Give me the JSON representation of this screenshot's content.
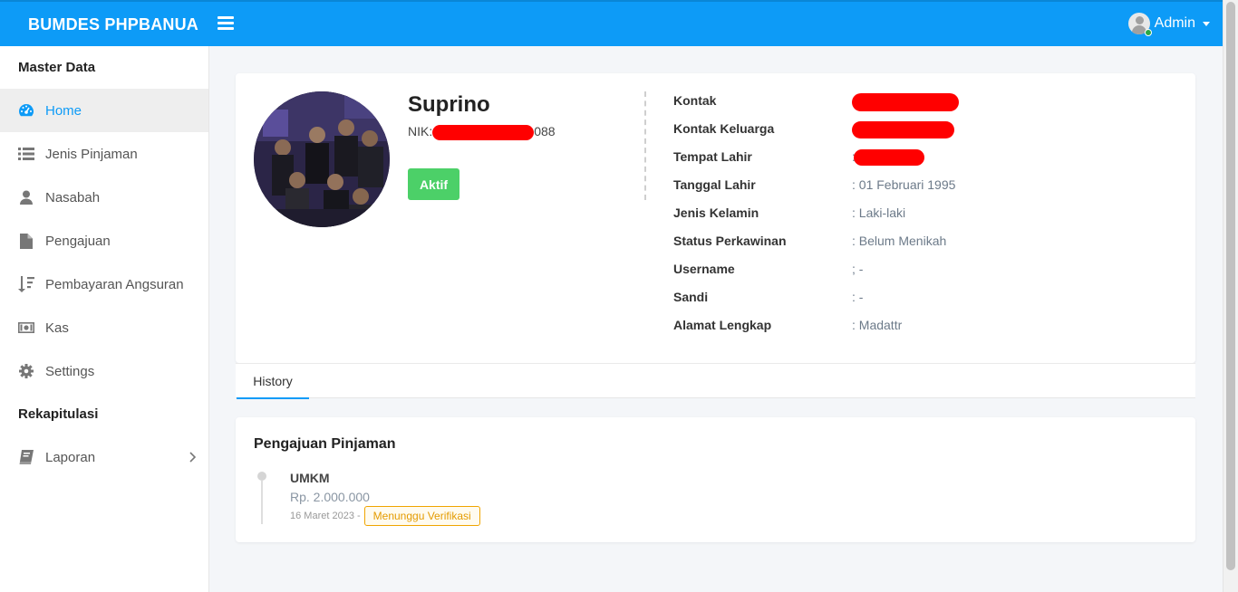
{
  "header": {
    "brand": "BUMDES PHPBANUA",
    "user_name": "Admin"
  },
  "sidebar": {
    "section_master": "Master Data",
    "items": [
      {
        "label": "Home",
        "icon": "dashboard-icon"
      },
      {
        "label": "Jenis Pinjaman",
        "icon": "list-icon"
      },
      {
        "label": "Nasabah",
        "icon": "user-icon"
      },
      {
        "label": "Pengajuan",
        "icon": "file-icon"
      },
      {
        "label": "Pembayaran Angsuran",
        "icon": "sort-icon"
      },
      {
        "label": "Kas",
        "icon": "money-icon"
      },
      {
        "label": "Settings",
        "icon": "gear-icon"
      }
    ],
    "section_recap": "Rekapitulasi",
    "recap_items": [
      {
        "label": "Laporan",
        "icon": "book-icon"
      }
    ]
  },
  "profile": {
    "name": "Suprino",
    "nik_prefix": "NIK:",
    "nik_suffix": "088",
    "status": "Aktif",
    "fields": [
      {
        "label": "Kontak",
        "value": ""
      },
      {
        "label": "Kontak Keluarga",
        "value": ""
      },
      {
        "label": "Tempat Lahir",
        "value": ":"
      },
      {
        "label": "Tanggal Lahir",
        "value": ": 01 Februari 1995"
      },
      {
        "label": "Jenis Kelamin",
        "value": ": Laki-laki"
      },
      {
        "label": "Status Perkawinan",
        "value": ": Belum Menikah"
      },
      {
        "label": "Username",
        "value": "; -"
      },
      {
        "label": "Sandi",
        "value": ": -"
      },
      {
        "label": "Alamat Lengkap",
        "value": ": Madattr"
      }
    ]
  },
  "tabs": [
    {
      "label": "History"
    }
  ],
  "history": {
    "title": "Pengajuan Pinjaman",
    "items": [
      {
        "type": "UMKM",
        "amount": "Rp. 2.000.000",
        "date": "16 Maret 2023 -",
        "badge": "Menunggu Verifikasi"
      }
    ]
  },
  "colors": {
    "primary": "#0d9bf7",
    "success": "#4cd068",
    "warning": "#f0a500",
    "redaction": "#ff0000"
  }
}
